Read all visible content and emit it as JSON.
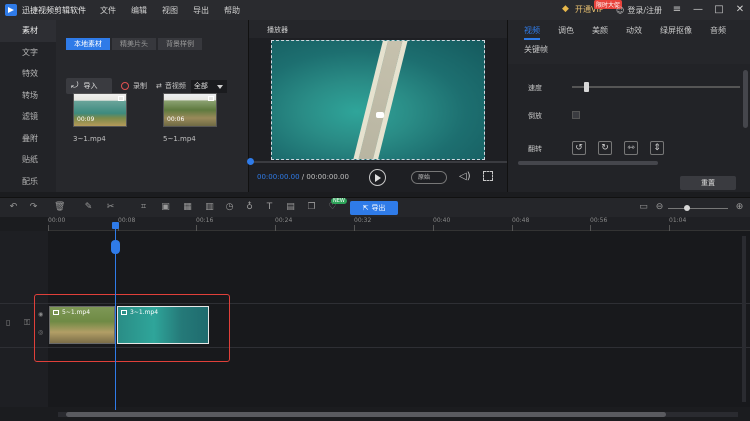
{
  "app": {
    "title": "迅捷视频剪辑软件"
  },
  "menu": [
    "文件",
    "编辑",
    "视图",
    "导出",
    "帮助"
  ],
  "account": {
    "vip_label": "开通VIP",
    "vip_badge": "限时大促",
    "login_label": "登录/注册"
  },
  "window_controls": {
    "menu_icon": "≡",
    "minimize": "—",
    "maximize": "□",
    "close": "✕"
  },
  "sidebar": {
    "items": [
      "素材",
      "文字",
      "特效",
      "转场",
      "滤镜",
      "叠附",
      "贴纸",
      "配乐"
    ],
    "active_index": 0
  },
  "media": {
    "tabs": [
      "本地素材",
      "精美片头",
      "背景样例"
    ],
    "active_tab": 0,
    "import_label": "导入",
    "record_label": "录制",
    "audio_video_label": "音视频",
    "filter_value": "全部",
    "thumbs": [
      {
        "name": "3~1.mp4",
        "duration": "00:09"
      },
      {
        "name": "5~1.mp4",
        "duration": "00:06"
      }
    ]
  },
  "player": {
    "title": "播放器",
    "current_time": "00:00:00.00",
    "separator": " / ",
    "total_time": "00:00:00.00",
    "ratio_label": "原始",
    "progress": 0
  },
  "properties": {
    "tabs": [
      "视频",
      "调色",
      "美颜",
      "动效",
      "绿屏抠像",
      "音频",
      "关键帧"
    ],
    "active_tab": 0,
    "speed_label": "速度",
    "reverse_label": "倒放",
    "flip_label": "翻转",
    "reset_label": "重置"
  },
  "timeline": {
    "export_label": "导出",
    "new_badge": "NEW",
    "ruler": [
      "00:00",
      "00:08",
      "00:16",
      "00:24",
      "00:32",
      "00:40",
      "00:48",
      "00:56",
      "01:04"
    ],
    "clips": [
      {
        "name": "5~1.mp4"
      },
      {
        "name": "3~1.mp4"
      }
    ]
  },
  "colors": {
    "accent": "#2f7be8",
    "highlight": "#e0403a",
    "panel": "#222327"
  }
}
